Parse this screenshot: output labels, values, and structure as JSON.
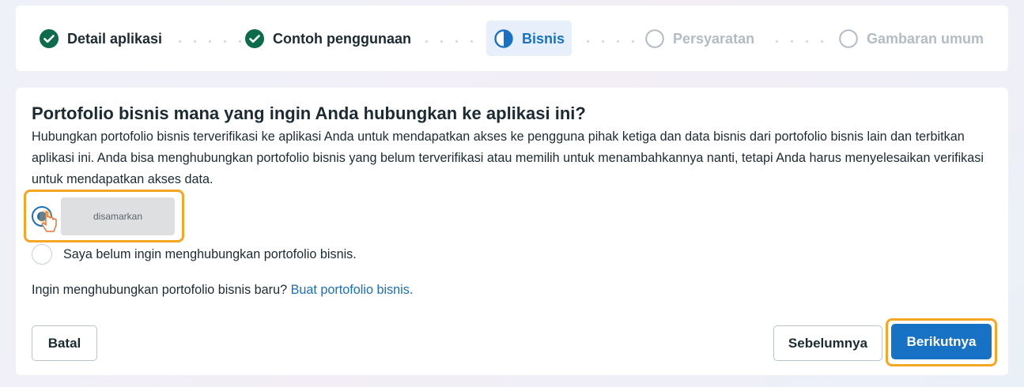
{
  "stepper": {
    "steps": [
      {
        "label": "Detail aplikasi",
        "state": "done"
      },
      {
        "label": "Contoh penggunaan",
        "state": "done"
      },
      {
        "label": "Bisnis",
        "state": "active"
      },
      {
        "label": "Persyaratan",
        "state": "pending"
      },
      {
        "label": "Gambaran umum",
        "state": "pending"
      }
    ]
  },
  "main": {
    "title": "Portofolio bisnis mana yang ingin Anda hubungkan ke aplikasi ini?",
    "description": "Hubungkan portofolio bisnis terverifikasi ke aplikasi Anda untuk mendapatkan akses ke pengguna pihak ketiga dan data bisnis dari portofolio bisnis lain dan terbitkan aplikasi ini. Anda bisa menghubungkan portofolio bisnis yang belum terverifikasi atau memilih untuk menambahkannya nanti, tetapi Anda harus menyelesaikan verifikasi untuk mendapatkan akses data.",
    "options": [
      {
        "label": "disamarkan",
        "selected": true
      },
      {
        "label": "Saya belum ingin menghubungkan portofolio bisnis.",
        "selected": false
      }
    ],
    "new_portfolio_text": "Ingin menghubungkan portofolio bisnis baru?",
    "new_portfolio_link": "Buat portofolio bisnis."
  },
  "footer": {
    "cancel_label": "Batal",
    "previous_label": "Sebelumnya",
    "next_label": "Berikutnya"
  },
  "colors": {
    "done_green": "#0b6b4a",
    "accent_blue": "#1772c5",
    "highlight_orange": "#f5a623"
  }
}
